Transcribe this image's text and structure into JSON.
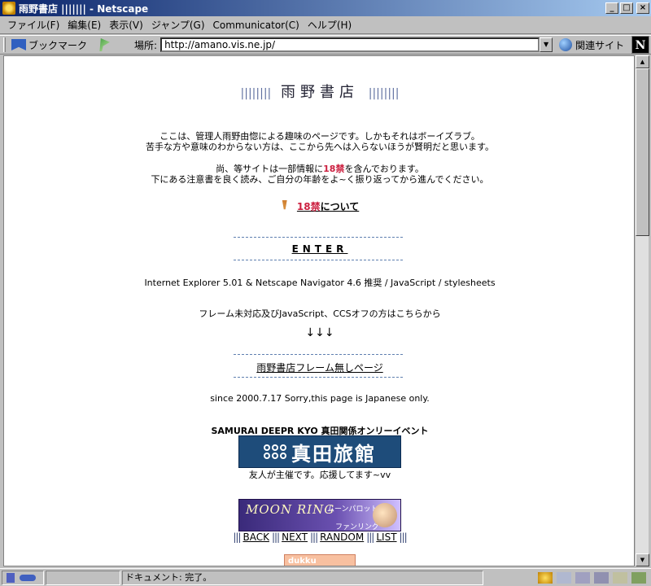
{
  "window": {
    "title": "雨野書店 ||||||| - Netscape",
    "controls": [
      "_",
      "□",
      "×"
    ]
  },
  "menu": [
    "ファイル(F)",
    "編集(E)",
    "表示(V)",
    "ジャンプ(G)",
    "Communicator(C)",
    "ヘルプ(H)"
  ],
  "toolbar": {
    "bookmarks_label": "ブックマーク",
    "location_label": "場所:",
    "location_value": "http://amano.vis.ne.jp/",
    "related_label": "関連サイト",
    "logo_letter": "N"
  },
  "page": {
    "title_bars_left": "||||||||",
    "title": "雨野書店",
    "title_bars_right": "||||||||",
    "intro_line1": "ここは、管理人雨野由惚による趣味のページです。しかもそれはボーイズラブ。",
    "intro_line2": "苦手な方や意味のわからない方は、ここから先へは入らないほうが賢明だと思います。",
    "notice_line1_pre": "尚、等サイトは一部情報に",
    "notice_line1_red": "18禁",
    "notice_line1_post": "を含んでおります。",
    "notice_line2": "下にある注意書を良く読み、ご自分の年齢をよ~く振り返ってから進んでください。",
    "r18_num": "18禁",
    "r18_text": "について",
    "enter": "ENTER",
    "browser_note": "Internet Explorer 5.01 & Netscape Navigator 4.6 推奨 / JavaScript / stylesheets",
    "noframe_note": "フレーム未対応及びJavaScript、CCSオフの方はこちらから",
    "arrows": "↓↓↓",
    "noframe_link": "雨野書店フレーム無しページ",
    "since": "since 2000.7.17  Sorry,this page is Japanese only.",
    "event_title": "SAMURAI DEEPR KYO 真田関係オンリーイベント",
    "banner_sanada": "真田旅館",
    "friend_note": "友人が主催です。応援してます~vv",
    "banner_moon_title": "MOON RING",
    "banner_moon_sub1": "ムーンパロット",
    "banner_moon_sub2": "ファンリング",
    "nav": [
      "BACK",
      "NEXT",
      "RANDOM",
      "LIST"
    ],
    "nav_sep": "|||",
    "dukku": "dukku"
  },
  "status": {
    "text": "ドキュメント: 完了。"
  },
  "colors": {
    "accent_red": "#cc2040",
    "dash_blue": "#6080b0",
    "title_gradient_start": "#0a246a"
  }
}
